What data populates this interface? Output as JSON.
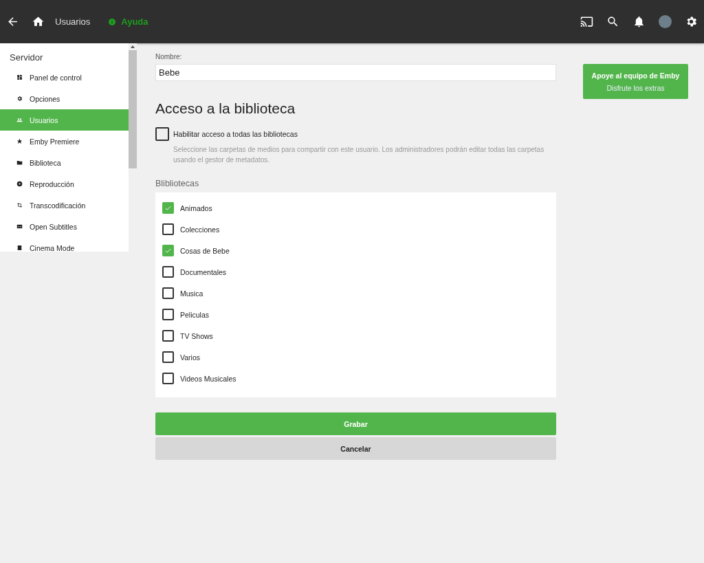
{
  "header": {
    "title": "Usuarios",
    "help": "Ayuda"
  },
  "sidebar": {
    "heading": "Servidor",
    "items": [
      {
        "label": "Panel de control",
        "selected": false
      },
      {
        "label": "Opciones",
        "selected": false
      },
      {
        "label": "Usuarios",
        "selected": true
      },
      {
        "label": "Emby Premiere",
        "selected": false
      },
      {
        "label": "Biblioteca",
        "selected": false
      },
      {
        "label": "Reproducción",
        "selected": false
      },
      {
        "label": "Transcodificación",
        "selected": false
      },
      {
        "label": "Open Subtitles",
        "selected": false
      },
      {
        "label": "Cinema Mode",
        "selected": false
      }
    ]
  },
  "form": {
    "name_label": "Nombre:",
    "name_value": "Bebe",
    "section_title": "Acceso a la biblioteca",
    "enable_all": {
      "label": "Habilitar acceso a todas las bibliotecas",
      "checked": false
    },
    "help_text": "Seleccione las carpetas de medios para compartir con este usuario. Los administradores podrán editar todas las carpetas usando el gestor de metadatos.",
    "libraries_title": "Blibliotecas",
    "libraries": [
      {
        "label": "Animados",
        "checked": true
      },
      {
        "label": "Colecciones",
        "checked": false
      },
      {
        "label": "Cosas de Bebe",
        "checked": true
      },
      {
        "label": "Documentales",
        "checked": false
      },
      {
        "label": "Musica",
        "checked": false
      },
      {
        "label": "Peliculas",
        "checked": false
      },
      {
        "label": "TV Shows",
        "checked": false
      },
      {
        "label": "Varios",
        "checked": false
      },
      {
        "label": "Videos Musicales",
        "checked": false
      }
    ],
    "save": "Grabar",
    "cancel": "Cancelar"
  },
  "promo": {
    "title": "Apoye al equipo de Emby",
    "subtitle": "Disfrute los extras"
  }
}
